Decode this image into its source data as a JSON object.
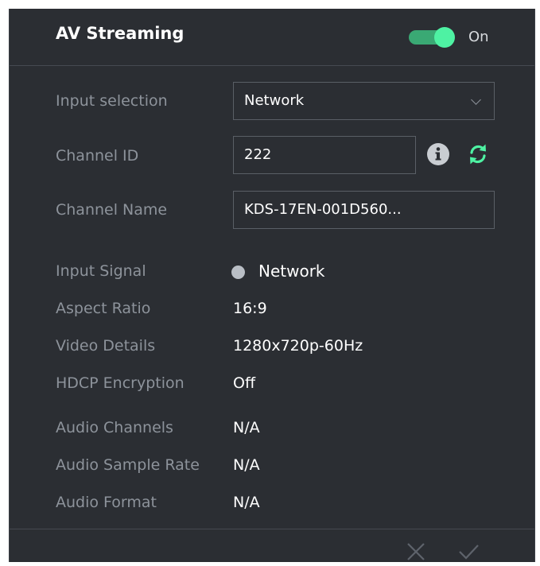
{
  "header": {
    "title": "AV Streaming",
    "toggle_state": "on",
    "toggle_label": "On"
  },
  "settings": {
    "input_selection": {
      "label": "Input selection",
      "value": "Network"
    },
    "channel_id": {
      "label": "Channel ID",
      "value": "222"
    },
    "channel_name": {
      "label": "Channel Name",
      "value": "KDS-17EN-001D560..."
    }
  },
  "status": {
    "input_signal": {
      "label": "Input Signal",
      "value": "Network"
    },
    "aspect_ratio": {
      "label": "Aspect Ratio",
      "value": "16:9"
    },
    "video_details": {
      "label": "Video Details",
      "value": "1280x720p-60Hz"
    },
    "hdcp_encryption": {
      "label": "HDCP Encryption",
      "value": "Off"
    },
    "audio_channels": {
      "label": "Audio Channels",
      "value": "N/A"
    },
    "audio_sample_rate": {
      "label": "Audio Sample Rate",
      "value": "N/A"
    },
    "audio_format": {
      "label": "Audio Format",
      "value": "N/A"
    }
  },
  "icons": {
    "info": "info-icon",
    "refresh": "refresh-icon",
    "dropdown": "chevron-down-icon",
    "cancel": "close-icon",
    "apply": "check-icon"
  },
  "colors": {
    "panel_background": "#2b2e33",
    "accent_green": "#4ef2a3",
    "toggle_track": "#3aa974",
    "label_text": "#8d939b",
    "value_text": "#ffffff"
  }
}
